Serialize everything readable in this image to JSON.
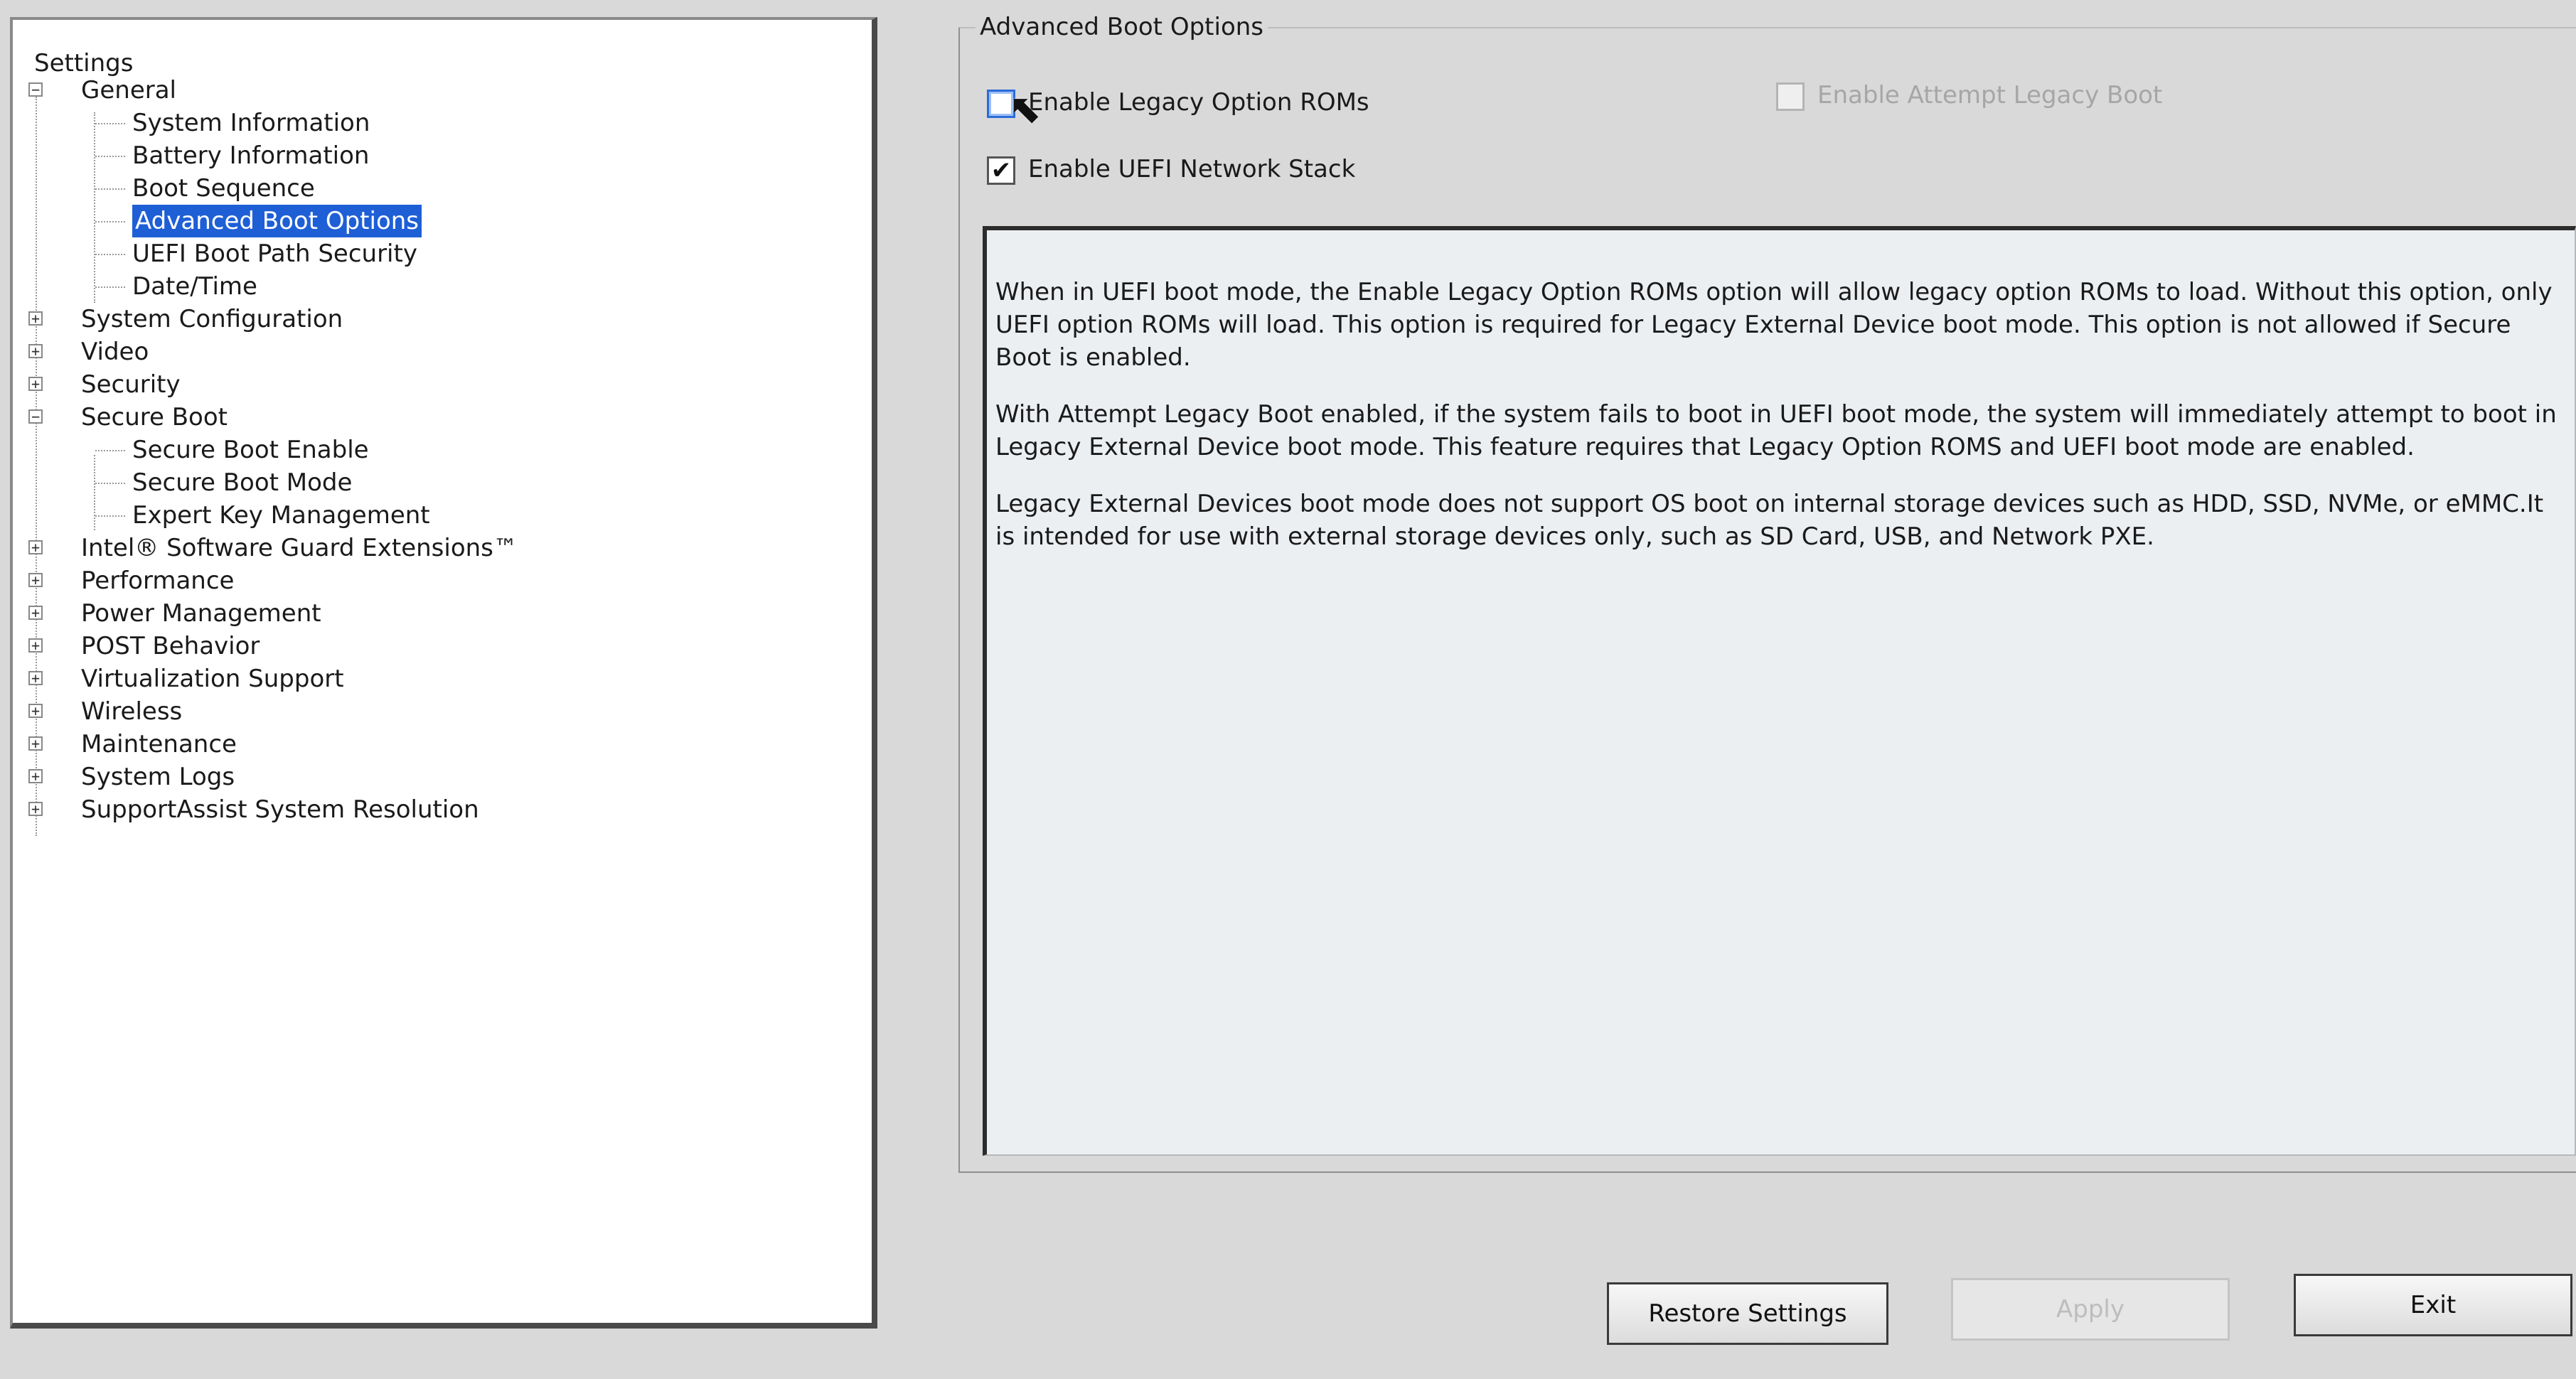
{
  "tree": {
    "root_label": "Settings",
    "general": {
      "label": "General",
      "expander": "−",
      "children": [
        "System Information",
        "Battery Information",
        "Boot Sequence",
        "Advanced Boot Options",
        "UEFI Boot Path Security",
        "Date/Time"
      ],
      "selected_child": "Advanced Boot Options"
    },
    "system_configuration": {
      "label": "System Configuration",
      "expander": "+"
    },
    "video": {
      "label": "Video",
      "expander": "+"
    },
    "security": {
      "label": "Security",
      "expander": "+"
    },
    "secure_boot": {
      "label": "Secure Boot",
      "expander": "−",
      "children": [
        "Secure Boot Enable",
        "Secure Boot Mode",
        "Expert Key Management"
      ]
    },
    "intel_sgx": {
      "label": "Intel® Software Guard Extensions™",
      "expander": "+"
    },
    "performance": {
      "label": "Performance",
      "expander": "+"
    },
    "power_management": {
      "label": "Power Management",
      "expander": "+"
    },
    "post_behavior": {
      "label": "POST Behavior",
      "expander": "+"
    },
    "virtualization_support": {
      "label": "Virtualization Support",
      "expander": "+"
    },
    "wireless": {
      "label": "Wireless",
      "expander": "+"
    },
    "maintenance": {
      "label": "Maintenance",
      "expander": "+"
    },
    "system_logs": {
      "label": "System Logs",
      "expander": "+"
    },
    "supportassist": {
      "label": "SupportAssist System Resolution",
      "expander": "+"
    }
  },
  "advanced_boot": {
    "group_title": "Advanced Boot Options",
    "legacy_option_roms": {
      "label": "Enable Legacy Option ROMs",
      "checked": false,
      "mark": ""
    },
    "uefi_network_stack": {
      "label": "Enable UEFI Network Stack",
      "checked": true,
      "mark": "✔"
    },
    "attempt_legacy_boot": {
      "label": "Enable Attempt Legacy Boot",
      "checked": false,
      "enabled": false,
      "mark": ""
    },
    "description": {
      "p1": "When in UEFI boot mode, the Enable Legacy Option ROMs option will allow legacy option ROMs to load. Without this option, only UEFI option ROMs will load. This option is required for Legacy External Device boot mode. This option is not allowed if Secure Boot is enabled.",
      "p2": "With Attempt Legacy Boot enabled, if the system fails to boot in UEFI boot mode, the system will immediately attempt to boot in Legacy External Device boot mode. This feature requires that Legacy Option ROMS and UEFI boot mode are enabled.",
      "p3": "Legacy External Devices boot mode does not support OS boot on internal storage devices such as HDD, SSD, NVMe, or eMMC.It is intended for use with external storage devices only, such as SD Card, USB, and Network PXE."
    }
  },
  "buttons": {
    "restore": "Restore Settings",
    "apply": "Apply",
    "exit": "Exit"
  },
  "cursor_glyph": "⬉",
  "colors": {
    "selection": "#1e5fd6",
    "background": "#d9d9d9"
  }
}
